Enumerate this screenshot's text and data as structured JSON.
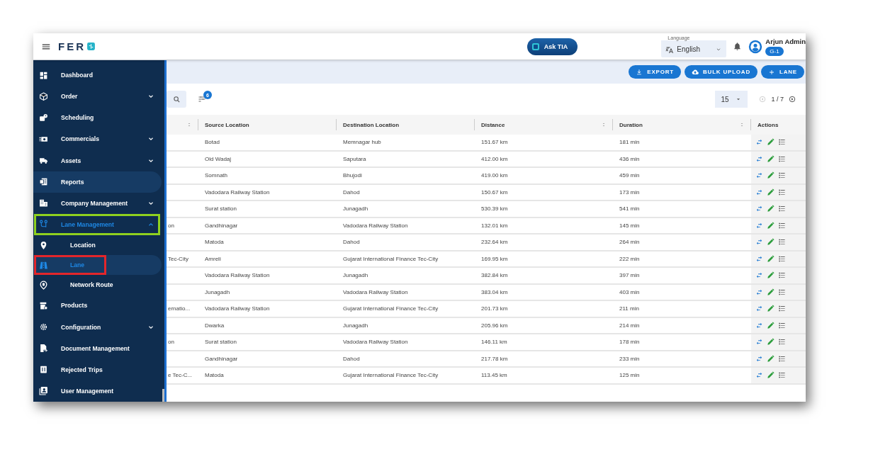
{
  "header": {
    "brand": "FER",
    "ask_button": "Ask TIA",
    "language": {
      "label": "Language",
      "value": "English"
    },
    "user": {
      "name": "Arjun Admin",
      "badge": "G-1"
    }
  },
  "sidebar": {
    "items": [
      {
        "label": "Dashboard",
        "expandable": false,
        "selected": false,
        "hovered": false
      },
      {
        "label": "Order",
        "expandable": true,
        "expanded": false,
        "selected": false,
        "hovered": false
      },
      {
        "label": "Scheduling",
        "expandable": false,
        "selected": false,
        "hovered": false
      },
      {
        "label": "Commercials",
        "expandable": true,
        "expanded": false,
        "selected": false,
        "hovered": false
      },
      {
        "label": "Assets",
        "expandable": true,
        "expanded": false,
        "selected": false,
        "hovered": false
      },
      {
        "label": "Reports",
        "expandable": false,
        "selected": false,
        "hovered": true
      },
      {
        "label": "Company Management",
        "expandable": true,
        "expanded": false,
        "selected": false,
        "hovered": false
      },
      {
        "label": "Lane Management",
        "expandable": true,
        "expanded": true,
        "selected": false,
        "hovered": false,
        "color": "#8fd11f",
        "children": [
          {
            "label": "Location",
            "selected": false
          },
          {
            "label": "Lane",
            "selected": true,
            "color": "#e3262b"
          },
          {
            "label": "Network Route",
            "selected": false
          }
        ]
      },
      {
        "label": "Products",
        "expandable": false,
        "selected": false,
        "hovered": false
      },
      {
        "label": "Configuration",
        "expandable": true,
        "expanded": false,
        "selected": false,
        "hovered": false
      },
      {
        "label": "Document Management",
        "expandable": false,
        "selected": false,
        "hovered": false
      },
      {
        "label": "Rejected Trips",
        "expandable": false,
        "selected": false,
        "hovered": false
      },
      {
        "label": "User Management",
        "expandable": false,
        "selected": false,
        "hovered": false
      }
    ]
  },
  "toolbar": {
    "buttons": [
      {
        "label": "EXPORT",
        "kind": "download"
      },
      {
        "label": "BULK UPLOAD",
        "kind": "upload"
      },
      {
        "label": "LANE",
        "kind": "add"
      }
    ]
  },
  "filters": {
    "filter_count": "6",
    "page_size": "15",
    "page": "1 / 7",
    "previous_disabled": true,
    "next_disabled": false
  },
  "table": {
    "columns": [
      {
        "sortable": true
      },
      {
        "label": "Source Location",
        "sortable": false
      },
      {
        "label": "Destination Location",
        "sortable": false
      },
      {
        "label": "Distance",
        "sortable": true
      },
      {
        "label": "Duration",
        "sortable": true
      },
      {
        "label": "Actions",
        "sortable": false
      }
    ],
    "rows": [
      {
        "source": "Botad",
        "destination": "Memnagar hub",
        "distance": "151.67 km",
        "duration": "181 min"
      },
      {
        "source": "Old Wadaj",
        "destination": "Saputara",
        "distance": "412.00 km",
        "duration": "436 min"
      },
      {
        "source": "Somnath",
        "destination": "Bhujodi",
        "distance": "419.00 km",
        "duration": "459 min"
      },
      {
        "source": "Vadodara Railway Station",
        "destination": "Dahod",
        "distance": "150.67 km",
        "duration": "173 min"
      },
      {
        "source": "Surat station",
        "destination": "Junagadh",
        "distance": "530.39 km",
        "duration": "541 min"
      },
      {
        "column_1": "on",
        "source": "Gandhinagar",
        "destination": "Vadodara Railway Station",
        "distance": "132.01 km",
        "duration": "145 min"
      },
      {
        "source": "Matoda",
        "destination": "Dahod",
        "distance": "232.64 km",
        "duration": "264 min"
      },
      {
        "column_1": "Tec-City",
        "source": "Amreli",
        "destination": "Gujarat International Finance Tec-City",
        "distance": "169.95 km",
        "duration": "222 min"
      },
      {
        "source": "Vadodara Railway Station",
        "destination": "Junagadh",
        "distance": "382.84 km",
        "duration": "397 min"
      },
      {
        "source": "Junagadh",
        "destination": "Vadodara Railway Station",
        "distance": "383.04 km",
        "duration": "403 min"
      },
      {
        "column_1": "ernatio...",
        "source": "Vadodara Railway Station",
        "destination": "Gujarat International Finance Tec-City",
        "distance": "201.73 km",
        "duration": "211 min"
      },
      {
        "source": "Dwarka",
        "destination": "Junagadh",
        "distance": "205.96 km",
        "duration": "214 min"
      },
      {
        "column_1": "on",
        "source": "Surat station",
        "destination": "Vadodara Railway Station",
        "distance": "146.11 km",
        "duration": "178 min"
      },
      {
        "source": "Gandhinagar",
        "destination": "Dahod",
        "distance": "217.78 km",
        "duration": "233 min"
      },
      {
        "column_1": "e Tec-C...",
        "source": "Matoda",
        "destination": "Gujarat International Finance Tec-City",
        "distance": "113.45 km",
        "duration": "125 min"
      }
    ]
  }
}
